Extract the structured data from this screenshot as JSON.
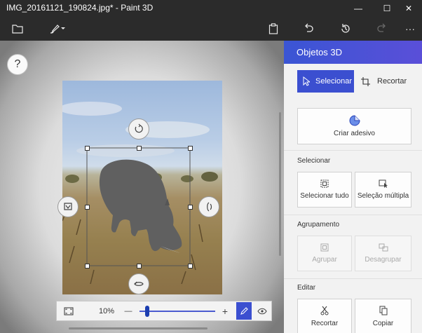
{
  "window": {
    "title": "IMG_20161121_190824.jpg* - Paint 3D"
  },
  "window_controls": {
    "minimize": "—",
    "maximize": "☐",
    "close": "✕"
  },
  "toolbar": {
    "more": "···"
  },
  "canvas": {
    "help_label": "?"
  },
  "zoom": {
    "level": "10%",
    "minus": "—",
    "plus": "+",
    "fraction": 0.1
  },
  "panel": {
    "title": "Objetos 3D",
    "select_label": "Selecionar",
    "crop_label": "Recortar",
    "sticker_label": "Criar adesivo",
    "section_select": "Selecionar",
    "select_all": "Selecionar tudo",
    "multi_select": "Seleção múltipla",
    "section_group": "Agrupamento",
    "group": "Agrupar",
    "ungroup": "Desagrupar",
    "section_edit": "Editar",
    "cut": "Recortar",
    "copy": "Copiar"
  },
  "colors": {
    "accent": "#3a55d4",
    "selected_tool": "#3b4fd0"
  }
}
